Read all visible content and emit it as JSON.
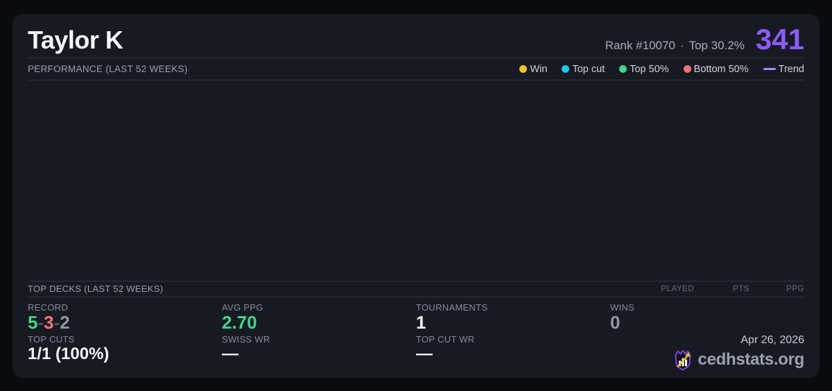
{
  "header": {
    "title": "Taylor K",
    "rank_text": "Rank #10070",
    "separator": "·",
    "top_percent_text": "Top 30.2%",
    "score": "341"
  },
  "performance": {
    "heading": "PERFORMANCE (LAST 52 WEEKS)",
    "legend": [
      {
        "label": "Win",
        "color": "#f0c420"
      },
      {
        "label": "Top cut",
        "color": "#26c6e8"
      },
      {
        "label": "Top 50%",
        "color": "#3dd68c"
      },
      {
        "label": "Bottom 50%",
        "color": "#f07171"
      },
      {
        "label": "Trend",
        "color": "#a78bfa"
      }
    ],
    "chart_empty": true
  },
  "top_decks": {
    "heading": "TOP DECKS (LAST 52 WEEKS)",
    "columns": [
      "PLAYED",
      "PTS",
      "PPG"
    ],
    "rows": []
  },
  "stats": {
    "record": {
      "label": "RECORD",
      "wins": "5",
      "losses": "3",
      "draws": "2",
      "sep": "-"
    },
    "avg_ppg": {
      "label": "AVG PPG",
      "value": "2.70"
    },
    "tournaments": {
      "label": "TOURNAMENTS",
      "value": "1"
    },
    "wins": {
      "label": "WINS",
      "value": "0"
    },
    "top_cuts": {
      "label": "TOP CUTS",
      "value": "1/1 (100%)"
    },
    "swiss_wr": {
      "label": "SWISS WR",
      "value": "—"
    },
    "top_cut_wr": {
      "label": "TOP CUT WR",
      "value": "—"
    }
  },
  "footer": {
    "date": "Apr 26, 2026",
    "brand": "cedhstats.org"
  },
  "colors": {
    "green": "#3fd68c",
    "red": "#f87171",
    "gray": "#8f97a4",
    "dash_gray": "#4b5563",
    "purple": "#8b5cf6",
    "trend": "#a78bfa"
  }
}
